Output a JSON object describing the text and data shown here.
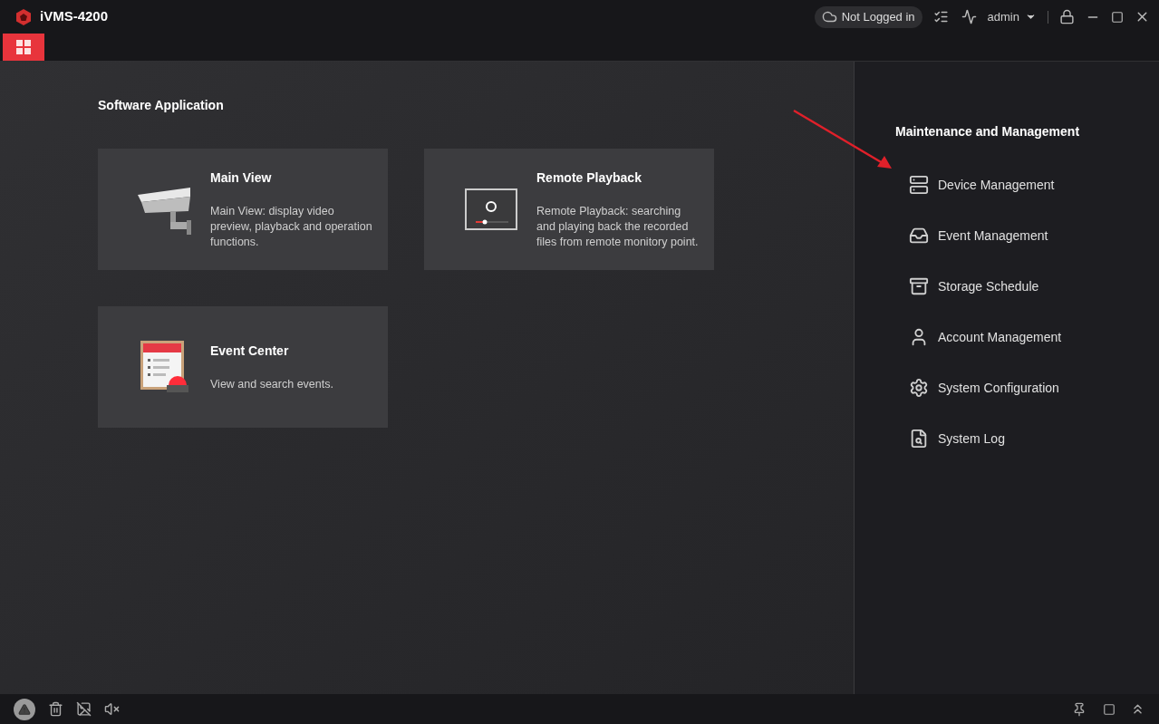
{
  "window": {
    "title": "iVMS-4200"
  },
  "header": {
    "login_status": "Not Logged in",
    "user": "admin"
  },
  "software": {
    "title": "Software Application",
    "apps": [
      {
        "kind": "camera",
        "title": "Main View",
        "description": "Main View: display video preview, playback and operation functions."
      },
      {
        "kind": "playback",
        "title": "Remote Playback",
        "description": "Remote Playback: searching and playing back the recorded files from remote monitory point."
      },
      {
        "kind": "event",
        "title": "Event Center",
        "description": "View and search events."
      }
    ]
  },
  "maintenance": {
    "title": "Maintenance and Management",
    "items": [
      {
        "kind": "device",
        "label": "Device Management"
      },
      {
        "kind": "event",
        "label": "Event Management"
      },
      {
        "kind": "storage",
        "label": "Storage Schedule"
      },
      {
        "kind": "account",
        "label": "Account Management"
      },
      {
        "kind": "config",
        "label": "System Configuration"
      },
      {
        "kind": "log",
        "label": "System Log"
      }
    ]
  }
}
